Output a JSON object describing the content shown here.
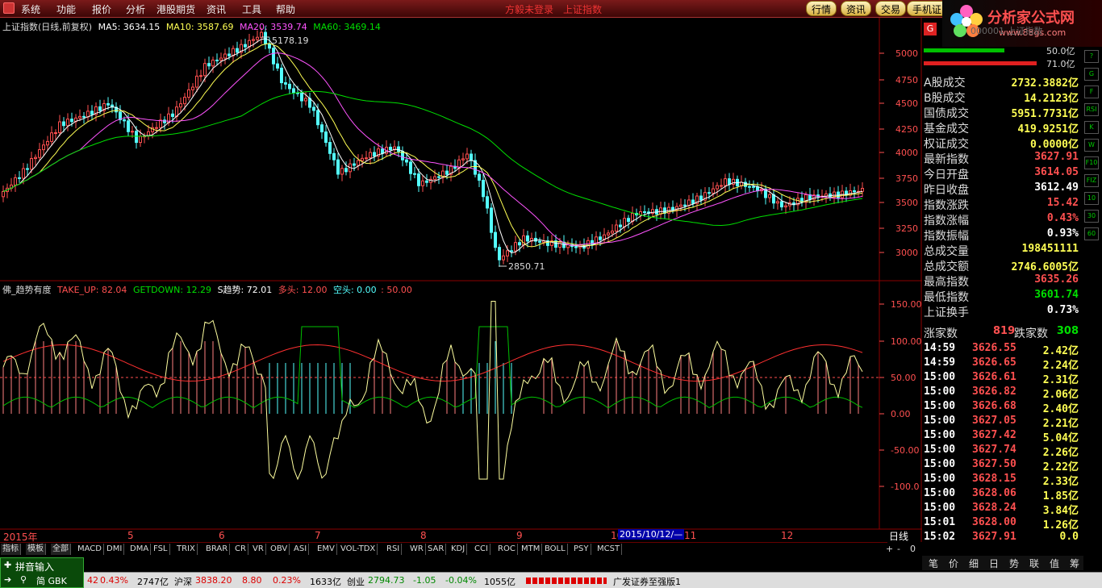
{
  "menu": {
    "items": [
      "系统",
      "功能",
      "报价",
      "分析",
      "港股期货",
      "资讯",
      "工具",
      "帮助"
    ],
    "title_left": "方毅未登录",
    "title_right": "上证指数",
    "right_tabs": [
      "行情",
      "资讯",
      "交易",
      "手机证"
    ]
  },
  "brand": {
    "name": "分析家公式网",
    "url": "www.88gs.com"
  },
  "kline": {
    "title": "上证指数(日线,前复权)",
    "ma5": "MA5: 3634.15",
    "ma10": "MA10: 3587.69",
    "ma20": "MA20: 3539.74",
    "ma60": "MA60: 3469.14",
    "high_label": "5178.19",
    "low_label": "2850.71",
    "yticks": [
      "5000",
      "4750",
      "4500",
      "4250",
      "4000",
      "3750",
      "3500",
      "3250",
      "3000"
    ],
    "colors": {
      "up": "#ff5050",
      "down": "#54ffff",
      "ma5": "#ffffff",
      "ma10": "#ffff54",
      "ma20": "#ff54ff",
      "ma60": "#00e000"
    }
  },
  "indicator": {
    "name": "佛_趋势有度",
    "take_up": "TAKE_UP: 82.04",
    "getdown": "GETDOWN: 12.29",
    "s": "S趋势: 72.01",
    "duo": "多头: 12.00",
    "kong": "空头: 0.00",
    "fifty": ": 50.00",
    "yticks": [
      "150.00",
      "100.00",
      "50.00",
      "0.00",
      "-50.00",
      "-100.0"
    ]
  },
  "xaxis": {
    "year": "2015年",
    "months": [
      "5",
      "6",
      "7",
      "8",
      "9",
      "10",
      "11",
      "12"
    ],
    "cursor_date": "2015/10/12/—",
    "period": "日线"
  },
  "tabs": [
    "指标",
    "模板",
    "全部",
    "MACD",
    "DMI",
    "DMA",
    "FSL",
    "TRIX",
    "BRAR",
    "CR",
    "VR",
    "OBV",
    "ASI",
    "EMV",
    "VOL-TDX",
    "RSI",
    "WR",
    "SAR",
    "KDJ",
    "CCI",
    "ROC",
    "MTM",
    "BOLL",
    "PSY",
    "MCST"
  ],
  "right": {
    "header": "000001 上证指数",
    "vol_top": "50.0亿",
    "vol_bottom": "71.0亿",
    "rows": [
      {
        "l": "A股成交",
        "v": "2732.3882亿",
        "c": "#ffff54"
      },
      {
        "l": "B股成交",
        "v": "14.2123亿",
        "c": "#ffff54"
      },
      {
        "l": "国债成交",
        "v": "5951.7731亿",
        "c": "#ffff54"
      },
      {
        "l": "基金成交",
        "v": "419.9251亿",
        "c": "#ffff54"
      },
      {
        "l": "权证成交",
        "v": "0.0000亿",
        "c": "#ffff54"
      },
      {
        "l": "最新指数",
        "v": "3627.91",
        "c": "#ff5050"
      },
      {
        "l": "今日开盘",
        "v": "3614.05",
        "c": "#ff5050"
      },
      {
        "l": "昨日收盘",
        "v": "3612.49",
        "c": "#ffffff"
      },
      {
        "l": "指数涨跌",
        "v": "15.42",
        "c": "#ff5050"
      },
      {
        "l": "指数涨幅",
        "v": "0.43%",
        "c": "#ff5050"
      },
      {
        "l": "指数振幅",
        "v": "0.93%",
        "c": "#ffffff"
      },
      {
        "l": "总成交量",
        "v": "198451111",
        "c": "#ffff54"
      },
      {
        "l": "总成交额",
        "v": "2746.6005亿",
        "c": "#ffff54"
      },
      {
        "l": "最高指数",
        "v": "3635.26",
        "c": "#ff5050"
      },
      {
        "l": "最低指数",
        "v": "3601.74",
        "c": "#00e000"
      },
      {
        "l": "上证换手",
        "v": "0.73%",
        "c": "#ffffff"
      }
    ],
    "updown": {
      "up_label": "涨家数",
      "up": "819",
      "down_label": "跌家数",
      "down": "308"
    },
    "ticks": [
      {
        "t": "14:59",
        "p": "3626.55",
        "v": "2.42亿"
      },
      {
        "t": "14:59",
        "p": "3626.65",
        "v": "2.24亿"
      },
      {
        "t": "15:00",
        "p": "3626.61",
        "v": "2.31亿"
      },
      {
        "t": "15:00",
        "p": "3626.82",
        "v": "2.06亿"
      },
      {
        "t": "15:00",
        "p": "3626.68",
        "v": "2.40亿"
      },
      {
        "t": "15:00",
        "p": "3627.05",
        "v": "2.21亿"
      },
      {
        "t": "15:00",
        "p": "3627.42",
        "v": "5.04亿"
      },
      {
        "t": "15:00",
        "p": "3627.74",
        "v": "2.26亿"
      },
      {
        "t": "15:00",
        "p": "3627.50",
        "v": "2.22亿"
      },
      {
        "t": "15:00",
        "p": "3628.15",
        "v": "2.33亿"
      },
      {
        "t": "15:00",
        "p": "3628.06",
        "v": "1.85亿"
      },
      {
        "t": "15:00",
        "p": "3628.24",
        "v": "3.84亿"
      },
      {
        "t": "15:01",
        "p": "3628.00",
        "v": "1.26亿"
      },
      {
        "t": "15:02",
        "p": "3627.91",
        "v": "0.0"
      }
    ],
    "bottom_tabs": [
      "笔",
      "价",
      "细",
      "日",
      "势",
      "联",
      "值",
      "筹"
    ]
  },
  "icons": [
    "?",
    "G",
    "F",
    "RSI",
    "K",
    "W",
    "F10",
    "FIZ",
    "10",
    "30",
    "60"
  ],
  "status": {
    "pct1": "42",
    "pct2": "0.43%",
    "amt1": "2747亿",
    "hs_label": "沪深",
    "hs_val": "3838.20",
    "hs_chg": "8.80",
    "hs_pct": "0.23%",
    "hs_amt": "1633亿",
    "cy_label": "创业",
    "cy_val": "2794.73",
    "cy_chg": "-1.05",
    "cy_pct": "-0.04%",
    "cy_amt": "1055亿",
    "broker": "广发证券至强版1"
  },
  "input": {
    "title": "拼音输入",
    "mode": "简 GBK"
  }
}
